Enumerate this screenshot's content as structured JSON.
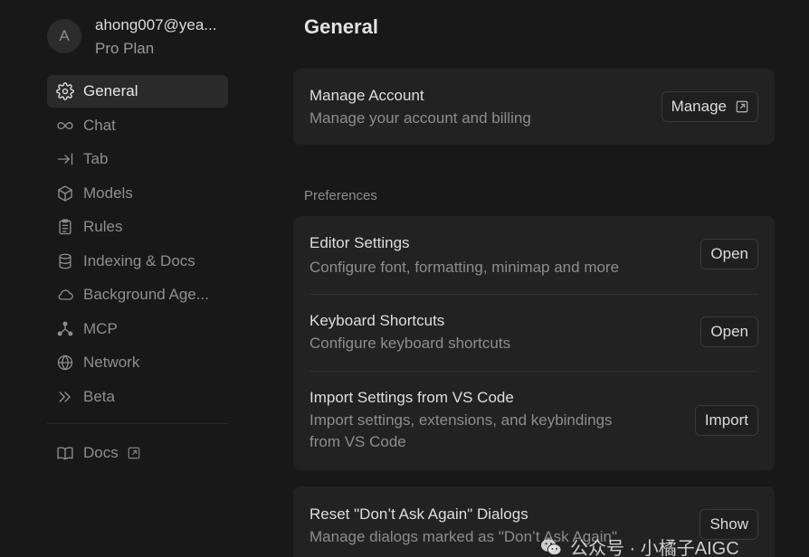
{
  "profile": {
    "avatar_letter": "A",
    "email": "ahong007@yea...",
    "plan": "Pro Plan"
  },
  "sidebar": {
    "items": [
      {
        "label": "General",
        "icon": "gear-icon",
        "active": true
      },
      {
        "label": "Chat",
        "icon": "infinity-icon"
      },
      {
        "label": "Tab",
        "icon": "tab-arrow-icon"
      },
      {
        "label": "Models",
        "icon": "cube-icon"
      },
      {
        "label": "Rules",
        "icon": "clipboard-icon"
      },
      {
        "label": "Indexing & Docs",
        "icon": "database-icon"
      },
      {
        "label": "Background Age...",
        "icon": "cloud-icon"
      },
      {
        "label": "MCP",
        "icon": "network-nodes-icon"
      },
      {
        "label": "Network",
        "icon": "globe-icon"
      },
      {
        "label": "Beta",
        "icon": "double-chevron-icon"
      }
    ],
    "docs_label": "Docs"
  },
  "main": {
    "title": "General",
    "account": {
      "title": "Manage Account",
      "description": "Manage your account and billing",
      "button": "Manage"
    },
    "preferences_label": "Preferences",
    "preferences": [
      {
        "title": "Editor Settings",
        "description": "Configure font, formatting, minimap and more",
        "button": "Open"
      },
      {
        "title": "Keyboard Shortcuts",
        "description": "Configure keyboard shortcuts",
        "button": "Open"
      },
      {
        "title": "Import Settings from VS Code",
        "description_line1": "Import settings, extensions, and keybindings",
        "description_line2": "from VS Code",
        "button": "Import"
      }
    ],
    "dialogs": {
      "title": "Reset \"Don’t Ask Again\" Dialogs",
      "description": "Manage dialogs marked as \"Don’t Ask Again\"",
      "button": "Show"
    }
  },
  "watermark": "公众号 · 小橘子AIGC"
}
